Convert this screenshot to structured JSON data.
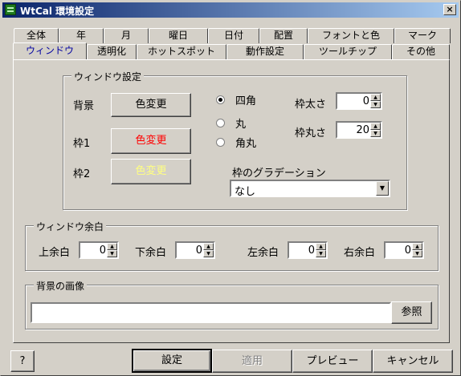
{
  "window": {
    "title": "WtCal 環境設定",
    "close_glyph": "×"
  },
  "tabs_back": [
    "全体",
    "年",
    "月",
    "曜日",
    "日付",
    "配置",
    "フォントと色",
    "マーク"
  ],
  "tabs_front": [
    "ウィンドウ",
    "透明化",
    "ホットスポット",
    "動作設定",
    "ツールチップ",
    "その他"
  ],
  "window_settings": {
    "title": "ウィンドウ設定",
    "bg_label": "背景",
    "frame1_label": "枠1",
    "frame2_label": "枠2",
    "color_button": "色変更",
    "shape_options": [
      "四角",
      "丸",
      "角丸"
    ],
    "selected_shape": "四角",
    "frame_width_label": "枠太さ",
    "frame_width_value": "0",
    "frame_round_label": "枠丸さ",
    "frame_round_value": "20",
    "gradation_label": "枠のグラデーション",
    "gradation_value": "なし",
    "colors": {
      "bg_text": "#000000",
      "frame1_text": "#ff0000",
      "frame2_text": "#ffff80"
    }
  },
  "margins": {
    "title": "ウィンドウ余白",
    "top_label": "上余白",
    "top_value": "0",
    "bottom_label": "下余白",
    "bottom_value": "0",
    "left_label": "左余白",
    "left_value": "0",
    "right_label": "右余白",
    "right_value": "0"
  },
  "background_image": {
    "title": "背景の画像",
    "path": "",
    "browse_button": "参照"
  },
  "footer": {
    "help": "?",
    "ok": "設定",
    "apply": "適用",
    "preview": "プレビュー",
    "cancel": "キャンセル"
  }
}
